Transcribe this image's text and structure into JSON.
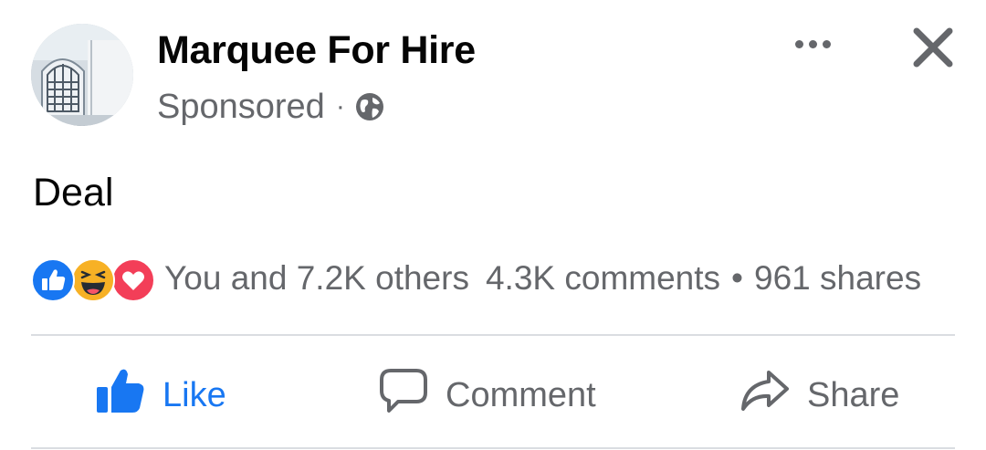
{
  "post": {
    "page_name": "Marquee For Hire",
    "sponsored_label": "Sponsored",
    "separator": "·",
    "audience_icon": "globe-icon",
    "more_icon": "more-horizontal-icon",
    "close_icon": "close-icon",
    "text": "Deal"
  },
  "reactions": {
    "icons": [
      "like-reaction-icon",
      "haha-reaction-icon",
      "love-reaction-icon"
    ],
    "summary": "You and 7.2K others",
    "comments": "4.3K comments",
    "bullet": "•",
    "shares": "961 shares"
  },
  "actions": {
    "like_label": "Like",
    "comment_label": "Comment",
    "share_label": "Share"
  },
  "colors": {
    "like_blue": "#1877f2",
    "secondary_text": "#65676b",
    "primary_text": "#050505",
    "love_red": "#f33e58",
    "haha_yellow": "#f7b125",
    "divider": "#dadde1"
  }
}
